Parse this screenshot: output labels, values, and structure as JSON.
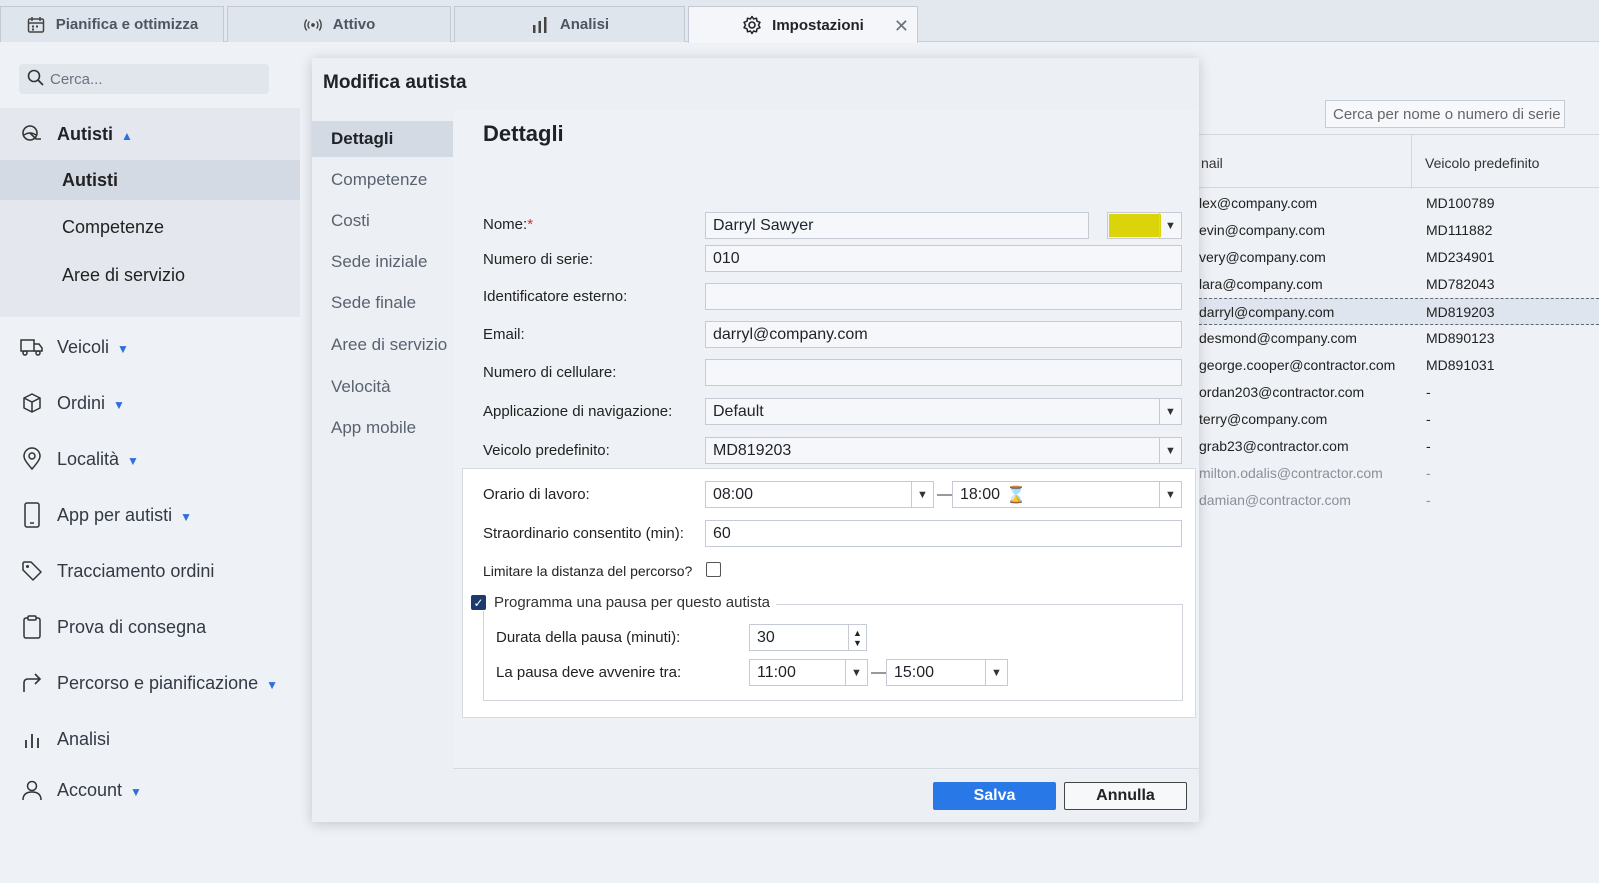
{
  "tabs": [
    {
      "label": "Pianifica e ottimizza",
      "icon": "calendar-icon"
    },
    {
      "label": "Attivo",
      "icon": "broadcast-icon"
    },
    {
      "label": "Analisi",
      "icon": "bar-chart-icon"
    },
    {
      "label": "Impostazioni",
      "icon": "gear-icon",
      "active": true
    }
  ],
  "tab_close": "✕",
  "sidebar": {
    "search_placeholder": "Cerca...",
    "items": [
      {
        "label": "Autisti",
        "icon": "steering-icon",
        "expanded": true
      },
      {
        "label": "Veicoli",
        "icon": "truck-icon"
      },
      {
        "label": "Ordini",
        "icon": "box-icon"
      },
      {
        "label": "Località",
        "icon": "location-pin-icon"
      },
      {
        "label": "App per autisti",
        "icon": "phone-icon"
      },
      {
        "label": "Tracciamento ordini",
        "icon": "tag-icon"
      },
      {
        "label": "Prova di consegna",
        "icon": "clipboard-icon"
      },
      {
        "label": "Percorso e pianificazione",
        "icon": "route-arrow-icon"
      },
      {
        "label": "Analisi",
        "icon": "bar-chart-icon"
      },
      {
        "label": "Account",
        "icon": "user-icon"
      }
    ],
    "subitems": [
      "Autisti",
      "Competenze",
      "Aree di servizio"
    ]
  },
  "background_table": {
    "search_placeholder": "Cerca per nome o numero di serie",
    "headers": [
      "nail",
      "Veicolo predefinito"
    ],
    "rows": [
      [
        "lex@company.com",
        "MD100789"
      ],
      [
        "evin@company.com",
        "MD111882"
      ],
      [
        "very@company.com",
        "MD234901"
      ],
      [
        "lara@company.com",
        "MD782043"
      ],
      [
        "darryl@company.com",
        "MD819203"
      ],
      [
        "desmond@company.com",
        "MD890123"
      ],
      [
        "george.cooper@contractor.com",
        "MD891031"
      ],
      [
        "ordan203@contractor.com",
        "-"
      ],
      [
        "terry@company.com",
        "-"
      ],
      [
        "grab23@contractor.com",
        "-"
      ],
      [
        "milton.odalis@contractor.com",
        "-"
      ],
      [
        "damian@contractor.com",
        "-"
      ]
    ]
  },
  "dialog": {
    "title": "Modifica autista",
    "nav": [
      "Dettagli",
      "Competenze",
      "Costi",
      "Sede iniziale",
      "Sede finale",
      "Aree di servizio",
      "Velocità",
      "App mobile"
    ],
    "section_title": "Dettagli",
    "fields": {
      "name_label": "Nome:",
      "name_required": "*",
      "name_value": "Darryl Sawyer",
      "color": "#dcd40a",
      "serial_label": "Numero di serie:",
      "serial_value": "010",
      "external_id_label": "Identificatore esterno:",
      "external_id_value": "",
      "email_label": "Email:",
      "email_value": "darryl@company.com",
      "mobile_label": "Numero di cellulare:",
      "mobile_value": "",
      "nav_app_label": "Applicazione di navigazione:",
      "nav_app_value": "Default",
      "vehicle_label": "Veicolo predefinito:",
      "vehicle_value": "MD819203",
      "work_hours_label": "Orario di lavoro:",
      "work_start": "08:00",
      "work_end": "18:00",
      "overtime_label": "Straordinario consentito (min):",
      "overtime_value": "60",
      "limit_distance_label": "Limitare la distanza del percorso?",
      "limit_distance_checked": false,
      "break_label": "Programma una pausa per questo autista",
      "break_checked": true,
      "break_duration_label": "Durata della pausa (minuti):",
      "break_duration_value": "30",
      "break_window_label": "La pausa deve avvenire tra:",
      "break_start": "11:00",
      "break_end": "15:00"
    },
    "save_label": "Salva",
    "cancel_label": "Annulla"
  }
}
